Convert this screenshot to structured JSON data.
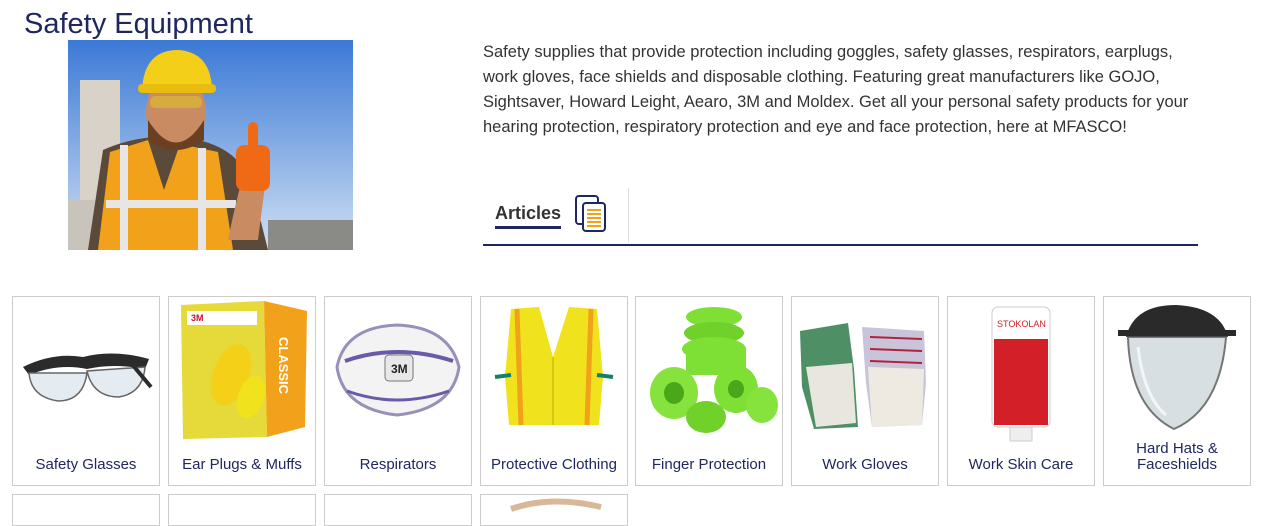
{
  "page": {
    "title": "Safety Equipment",
    "description": "Safety supplies that provide protection including goggles, safety glasses, respirators, earplugs, work gloves, face shields and disposable clothing. Featuring great manufacturers like GOJO, Sightsaver, Howard Leight, Aearo, 3M and Moldex. Get all your personal safety products for your hearing protection, respiratory protection and eye and face protection, here at MFASCO!"
  },
  "tabs": {
    "articles_label": "Articles",
    "articles_icon": "documents-icon"
  },
  "hero_image": {
    "depicts": "construction-worker-thumbs-up",
    "vest_color": "#f2a21a",
    "helmet_color": "#f4cf19"
  },
  "categories": [
    {
      "label": "Safety Glasses",
      "icon": "safety-glasses-icon"
    },
    {
      "label": "Ear Plugs & Muffs",
      "icon": "ear-plugs-box-icon"
    },
    {
      "label": "Respirators",
      "icon": "respirator-mask-icon",
      "brand": "3M"
    },
    {
      "label": "Protective Clothing",
      "icon": "safety-vest-icon"
    },
    {
      "label": "Finger Protection",
      "icon": "finger-tape-icon"
    },
    {
      "label": "Work Gloves",
      "icon": "work-gloves-icon"
    },
    {
      "label": "Work Skin Care",
      "icon": "skin-care-tube-icon",
      "brand": "STOKOLAN"
    },
    {
      "label": "Hard Hats & Faceshields",
      "icon": "faceshield-icon"
    }
  ],
  "colors": {
    "brand_navy": "#1f2760",
    "tile_border": "#cccccc",
    "accent_green": "#7ee035",
    "accent_yellow": "#f1e21e"
  }
}
